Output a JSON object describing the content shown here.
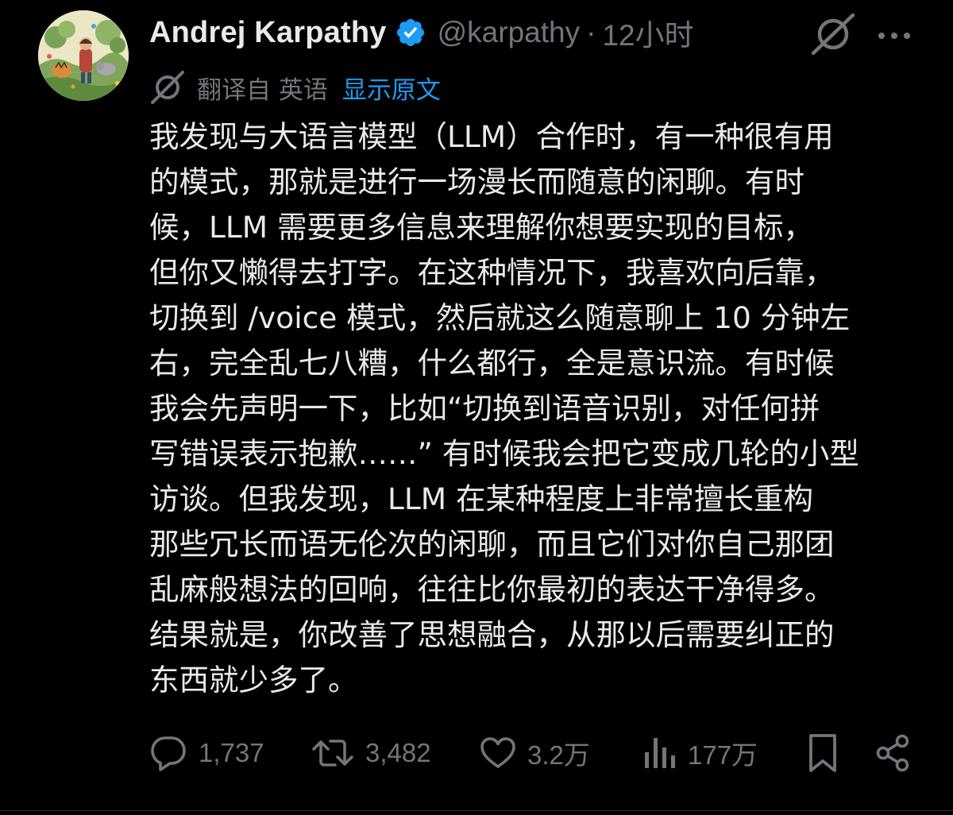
{
  "author": {
    "display_name": "Andrej Karpathy",
    "handle": "@karpathy",
    "separator": "·",
    "time": "12小时",
    "verified": true,
    "verified_color": "#1d9bf0"
  },
  "translation": {
    "label": "翻译自 英语",
    "show_original": "显示原文",
    "link_color": "#1d9bf0"
  },
  "body": {
    "lines": [
      "我发现与大语言模型（LLM）合作时，有一种很有用",
      "的模式，那就是进行一场漫长而随意的闲聊。有时",
      "候，LLM 需要更多信息来理解你想要实现的目标，",
      "但你又懒得去打字。在这种情况下，我喜欢向后靠，",
      "切换到 /voice 模式，然后就这么随意聊上 10 分钟左",
      "右，完全乱七八糟，什么都行，全是意识流。有时候",
      "我会先声明一下，比如“切换到语音识别，对任何拼",
      "写错误表示抱歉……” 有时候我会把它变成几轮的小型",
      "访谈。但我发现，LLM 在某种程度上非常擅长重构",
      "那些冗长而语无伦次的闲聊，而且它们对你自己那团",
      "乱麻般想法的回响，往往比你最初的表达干净得多。",
      "结果就是，你改善了思想融合，从那以后需要纠正的",
      "东西就少多了。"
    ]
  },
  "actions": {
    "replies": "1,737",
    "reposts": "3,482",
    "likes": "3.2万",
    "views": "177万"
  },
  "icons": {
    "header": [
      "verified-badge-icon",
      "grok-icon",
      "more-icon"
    ],
    "translation": "translate-icon",
    "actions": [
      "reply-icon",
      "repost-icon",
      "like-icon",
      "views-icon",
      "bookmark-icon",
      "share-icon"
    ]
  },
  "colors": {
    "background": "#000000",
    "text_primary": "#e7e9ea",
    "text_secondary": "#71767b"
  }
}
